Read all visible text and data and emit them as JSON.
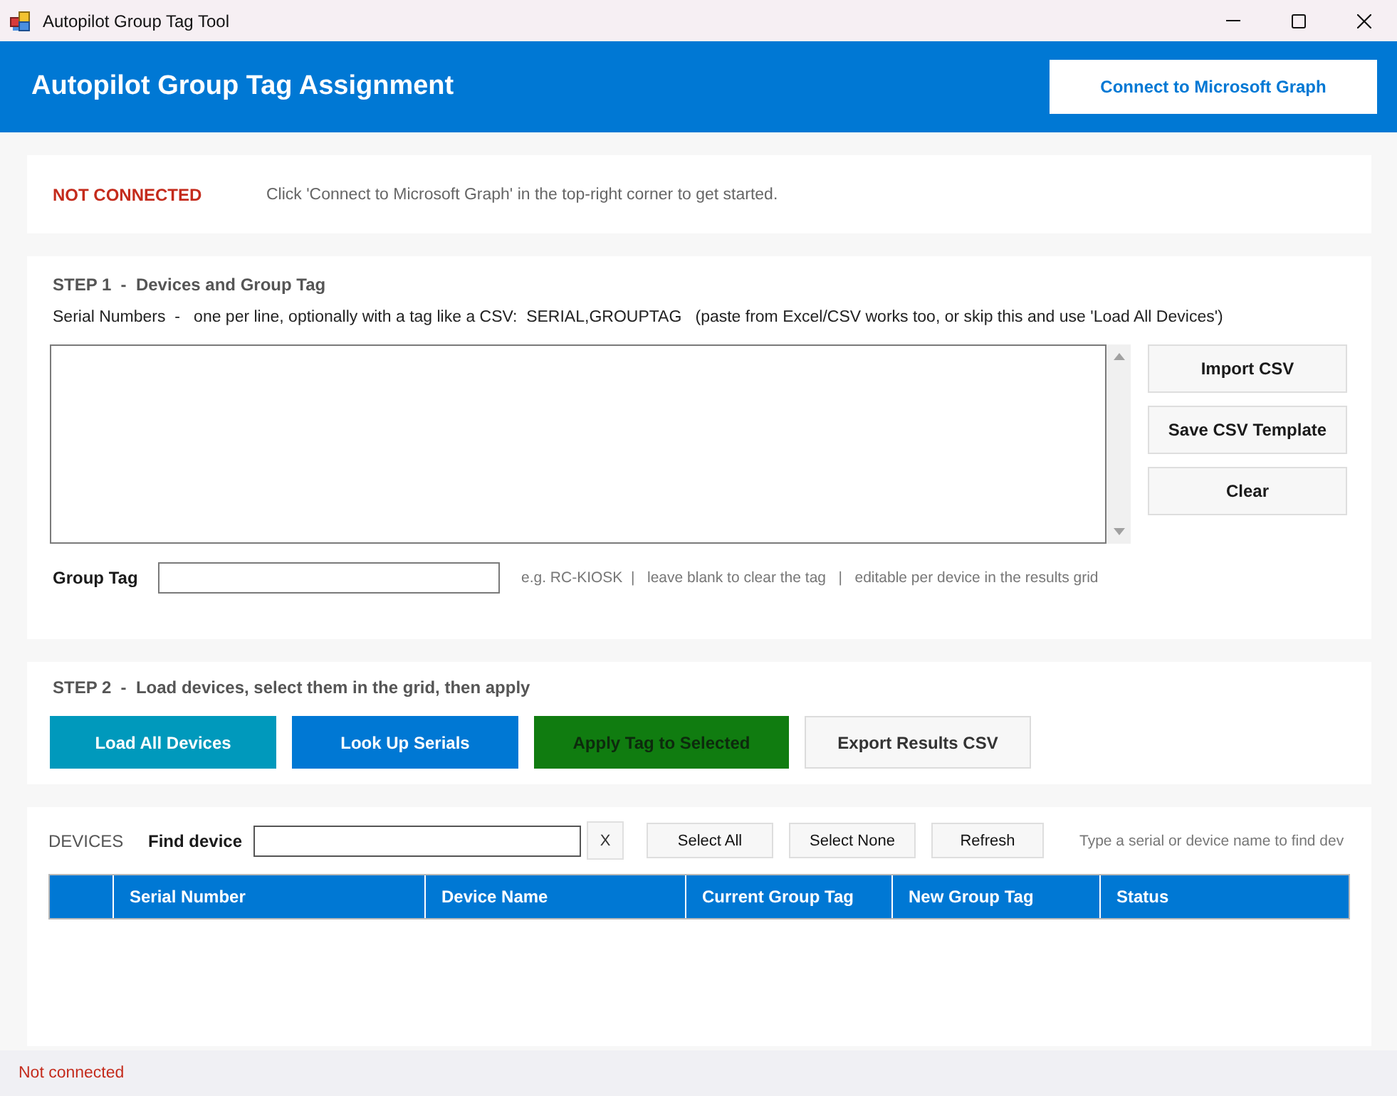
{
  "window": {
    "title": "Autopilot Group Tag Tool"
  },
  "header": {
    "title": "Autopilot Group Tag Assignment",
    "connect_button": "Connect to Microsoft Graph"
  },
  "status": {
    "connected": false,
    "label": "NOT CONNECTED",
    "message": "Click 'Connect to Microsoft Graph' in the top-right corner to get started."
  },
  "step1": {
    "title": "STEP 1  -  Devices and Group Tag",
    "serial_label": "Serial Numbers  -   one per line, optionally with a tag like a CSV:  SERIAL,GROUPTAG   (paste from Excel/CSV works too, or skip this and use 'Load All Devices')",
    "buttons": [
      "Import CSV",
      "Save CSV Template",
      "Clear"
    ],
    "group_tag_label": "Group Tag",
    "group_tag_hint": "e.g. RC-KIOSK  |   leave blank to clear the tag   |   editable per device in the results grid"
  },
  "step2": {
    "title": "STEP 2  -  Load devices, select them in the grid, then apply",
    "buttons": [
      {
        "label": "Load All Devices",
        "kind": "filled",
        "color": "#0099bc",
        "disabled": false
      },
      {
        "label": "Look Up Serials",
        "kind": "filled",
        "color": "#0078d4",
        "disabled": false
      },
      {
        "label": "Apply Tag to Selected",
        "kind": "filled",
        "color": "#107c10",
        "disabled": true
      },
      {
        "label": "Export Results CSV",
        "kind": "plain",
        "disabled": false
      }
    ]
  },
  "devices": {
    "title": "DEVICES",
    "find_label": "Find device",
    "clear_button": "X",
    "buttons": [
      "Select All",
      "Select None",
      "Refresh"
    ],
    "hint": "Type a serial or device name to find dev",
    "columns": [
      "Serial Number",
      "Device Name",
      "Current Group Tag",
      "New Group Tag",
      "Status"
    ]
  },
  "status_bar": {
    "text": "Not connected"
  }
}
